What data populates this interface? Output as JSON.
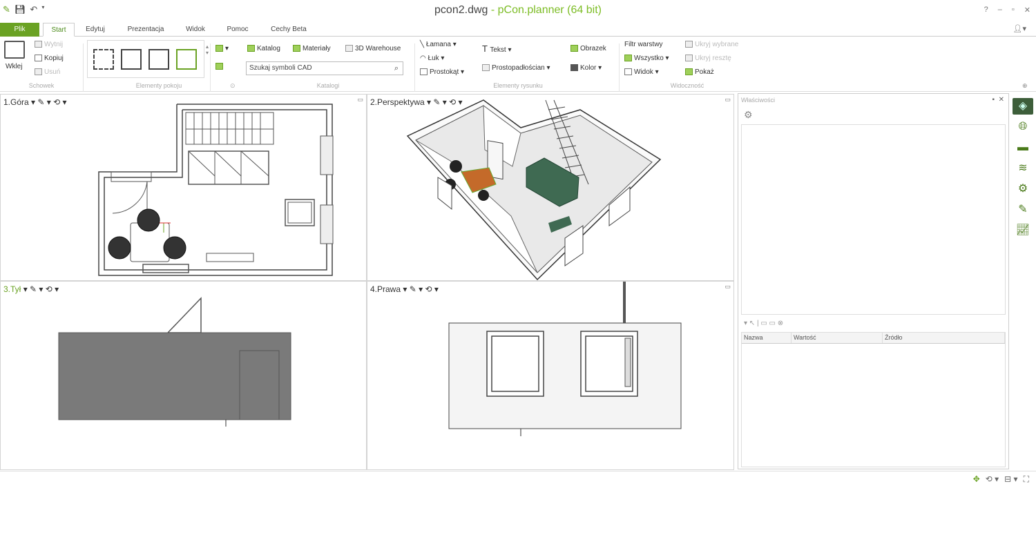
{
  "titlebar": {
    "file": "pcon2.dwg",
    "separator": "-",
    "app": "pCon.planner (64 bit)",
    "quick_access": [
      "pencil-icon",
      "save-icon",
      "undo-icon"
    ],
    "window_buttons": [
      "?",
      "–",
      "▫",
      "✕"
    ]
  },
  "tabs": [
    "Plik",
    "Start",
    "Edytuj",
    "Prezentacja",
    "Widok",
    "Pomoc",
    "Cechy Beta"
  ],
  "active_tab": "Start",
  "ribbon": {
    "clipboard": {
      "paste": "Wklej",
      "cut": "Wytnij",
      "copy": "Kopiuj",
      "delete": "Usuń",
      "group": "Schowek"
    },
    "room_elements": {
      "group": "Elementy pokoju"
    },
    "catalog": {
      "catalog": "Katalog",
      "materials": "Materiały",
      "warehouse": "3D Warehouse",
      "search_placeholder": "Szukaj symboli CAD",
      "group": "Katalogi"
    },
    "drawing": {
      "polyline": "Łamana",
      "arc": "Łuk",
      "rectangle": "Prostokąt",
      "text": "Tekst",
      "box": "Prostopadłościan",
      "image": "Obrazek",
      "color": "Kolor",
      "group": "Elementy rysunku"
    },
    "visibility": {
      "layer_filter": "Filtr warstwy",
      "all": "Wszystko",
      "view": "Widok",
      "hide_selected": "Ukryj wybrane",
      "hide_rest": "Ukryj resztę",
      "show": "Pokaż",
      "group": "Widoczność"
    }
  },
  "viewports": [
    {
      "label": "1.Góra"
    },
    {
      "label": "2.Perspektywa"
    },
    {
      "label": "3.Tył"
    },
    {
      "label": "4.Prawa"
    }
  ],
  "properties": {
    "title": "Właściwości",
    "columns": [
      "Nazwa",
      "Wartość",
      "Źródło"
    ]
  },
  "colors": {
    "accent": "#6aa223",
    "wall_gray": "#7a7a7a",
    "sofa": "#3f6a52",
    "table": "#c46a2a"
  }
}
